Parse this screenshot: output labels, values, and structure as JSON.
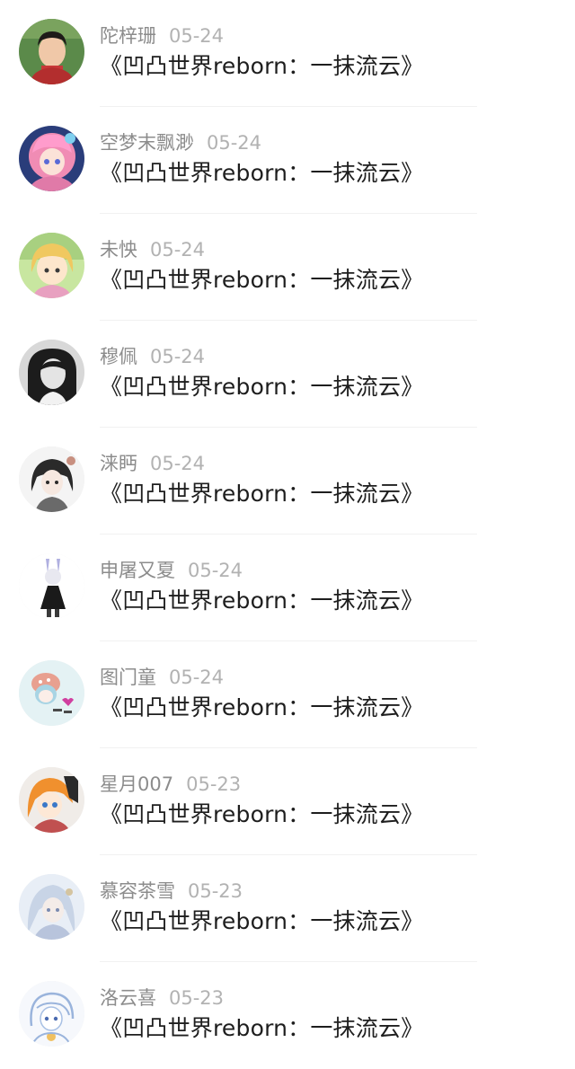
{
  "comments": [
    {
      "name": "陀梓珊",
      "date": "05-24",
      "text": "《凹凸世界reborn：一抹流云》",
      "avatar_icon": "avatar-boy-photo-icon"
    },
    {
      "name": "空梦末飘渺",
      "date": "05-24",
      "text": "《凹凸世界reborn：一抹流云》",
      "avatar_icon": "avatar-pink-hair-anime-icon"
    },
    {
      "name": "未怏",
      "date": "05-24",
      "text": "《凹凸世界reborn：一抹流云》",
      "avatar_icon": "avatar-blonde-anime-icon"
    },
    {
      "name": "穆佩",
      "date": "05-24",
      "text": "《凹凸世界reborn：一抹流云》",
      "avatar_icon": "avatar-bw-girl-photo-icon"
    },
    {
      "name": "涞眄",
      "date": "05-24",
      "text": "《凹凸世界reborn：一抹流云》",
      "avatar_icon": "avatar-dark-hair-anime-icon"
    },
    {
      "name": "申屠又夏",
      "date": "05-24",
      "text": "《凹凸世界reborn：一抹流云》",
      "avatar_icon": "avatar-chibi-dress-icon"
    },
    {
      "name": "图门童",
      "date": "05-24",
      "text": "《凹凸世界reborn：一抹流云》",
      "avatar_icon": "avatar-chibi-blue-icon"
    },
    {
      "name": "星月007",
      "date": "05-23",
      "text": "《凹凸世界reborn：一抹流云》",
      "avatar_icon": "avatar-orange-hair-anime-icon"
    },
    {
      "name": "慕容茶雪",
      "date": "05-23",
      "text": "《凹凸世界reborn：一抹流云》",
      "avatar_icon": "avatar-silver-anime-icon"
    },
    {
      "name": "洛云喜",
      "date": "05-23",
      "text": "《凹凸世界reborn：一抹流云》",
      "avatar_icon": "avatar-sketch-blue-icon"
    }
  ]
}
